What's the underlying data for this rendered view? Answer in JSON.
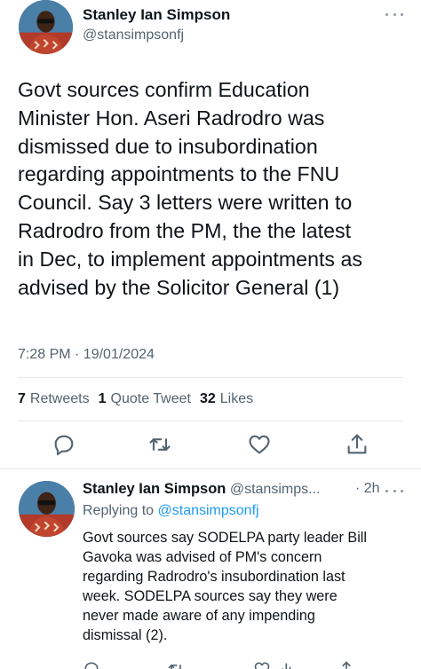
{
  "main_tweet": {
    "author_name": "Stanley Ian Simpson",
    "author_handle": "@stansimpsonfj",
    "text": "Govt sources confirm Education\nMinister Hon. Aseri Radrodro was\ndismissed due to insubordination\nregarding appointments to the FNU\nCouncil. Say 3 letters were written to\nRadrodro from the PM, the the latest\nin Dec, to implement appointments as\nadvised by the Solicitor General (1)",
    "timestamp": "7:28 PM · 19/01/2024",
    "stats": {
      "retweets_count": "7",
      "retweets_label": "Retweets",
      "quotes_count": "1",
      "quotes_label": "Quote Tweet",
      "likes_count": "32",
      "likes_label": "Likes"
    },
    "actions": [
      "reply-icon",
      "retweet-icon",
      "like-icon",
      "share-icon"
    ]
  },
  "reply_tweet": {
    "author_name": "Stanley Ian Simpson",
    "author_handle_truncated": "@stansimps...",
    "time_ago": "· 2h",
    "replying_prefix": "Replying to",
    "replying_to": "@stansimpsonfj",
    "text": "Govt sources say SODELPA party leader Bill\nGavoka was advised of PM's concern\nregarding Radrodro's insubordination last\nweek. SODELPA sources say they were\nnever made aware of any impending\ndismissal (2).",
    "actions": [
      "reply-icon",
      "retweet-icon",
      "like-icon",
      "views-icon",
      "share-icon"
    ]
  },
  "colors": {
    "text_primary": "#0f1419",
    "text_secondary": "#536471",
    "link": "#1d9bf0",
    "divider": "#e3e7ea",
    "icon": "#536471"
  }
}
